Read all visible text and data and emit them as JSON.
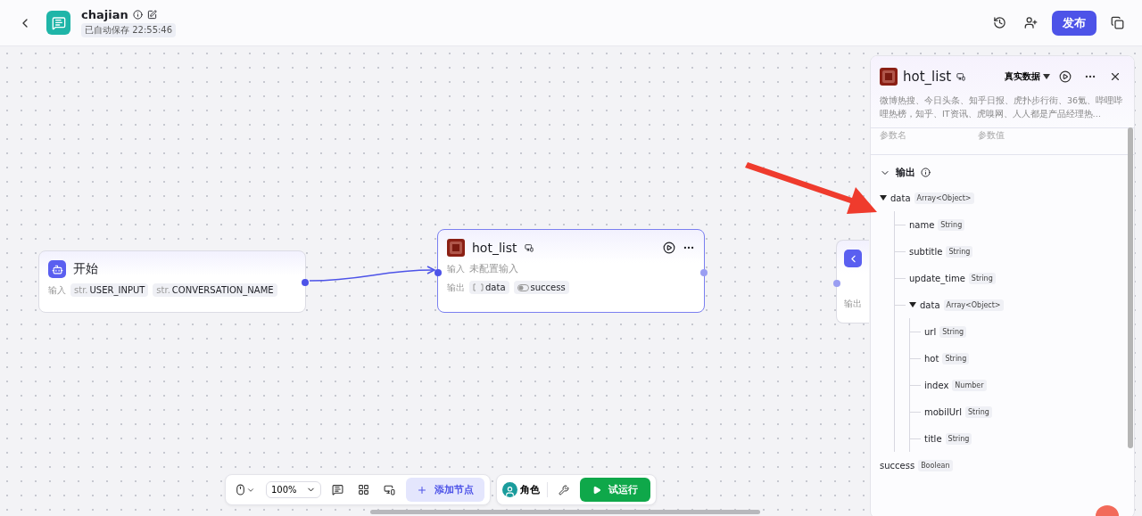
{
  "header": {
    "title": "chajian",
    "saved": "已自动保存 22:55:46",
    "publish": "发布"
  },
  "nodes": [
    {
      "kind": "start",
      "title": "开始",
      "input_label": "输入",
      "inputs": [
        {
          "prefix": "str.",
          "name": "USER_INPUT"
        },
        {
          "prefix": "str.",
          "name": "CONVERSATION_NAME"
        }
      ]
    },
    {
      "kind": "plugin",
      "title": "hot_list",
      "selected": true,
      "input_label": "输入",
      "input_value": "未配置输入",
      "output_label": "输出",
      "outputs": [
        {
          "kind": "array",
          "name": "data"
        },
        {
          "kind": "bool",
          "name": "success"
        }
      ]
    },
    {
      "kind": "end",
      "label": "输出"
    }
  ],
  "panel": {
    "title": "hot_list",
    "mode": "真实数据",
    "description": "微博热搜、今日头条、知乎日报、虎扑步行街、36氪、哔哩哔哩热榜，知乎、IT资讯、虎嗅网、人人都是产品经理热…",
    "param_name": "参数名",
    "param_value": "参数值",
    "section": "输出",
    "section_expanded": true,
    "tree": [
      {
        "name": "data",
        "type": "Array<Object>",
        "expanded": true,
        "children": [
          {
            "name": "name",
            "type": "String"
          },
          {
            "name": "subtitle",
            "type": "String"
          },
          {
            "name": "update_time",
            "type": "String"
          },
          {
            "name": "data",
            "type": "Array<Object>",
            "expanded": true,
            "children": [
              {
                "name": "url",
                "type": "String"
              },
              {
                "name": "hot",
                "type": "String"
              },
              {
                "name": "index",
                "type": "Number"
              },
              {
                "name": "mobilUrl",
                "type": "String"
              },
              {
                "name": "title",
                "type": "String"
              }
            ]
          }
        ]
      },
      {
        "name": "success",
        "type": "Boolean"
      }
    ]
  },
  "toolbar": {
    "zoom": "100%",
    "add_node": "添加节点",
    "role": "角色",
    "run": "试运行"
  }
}
